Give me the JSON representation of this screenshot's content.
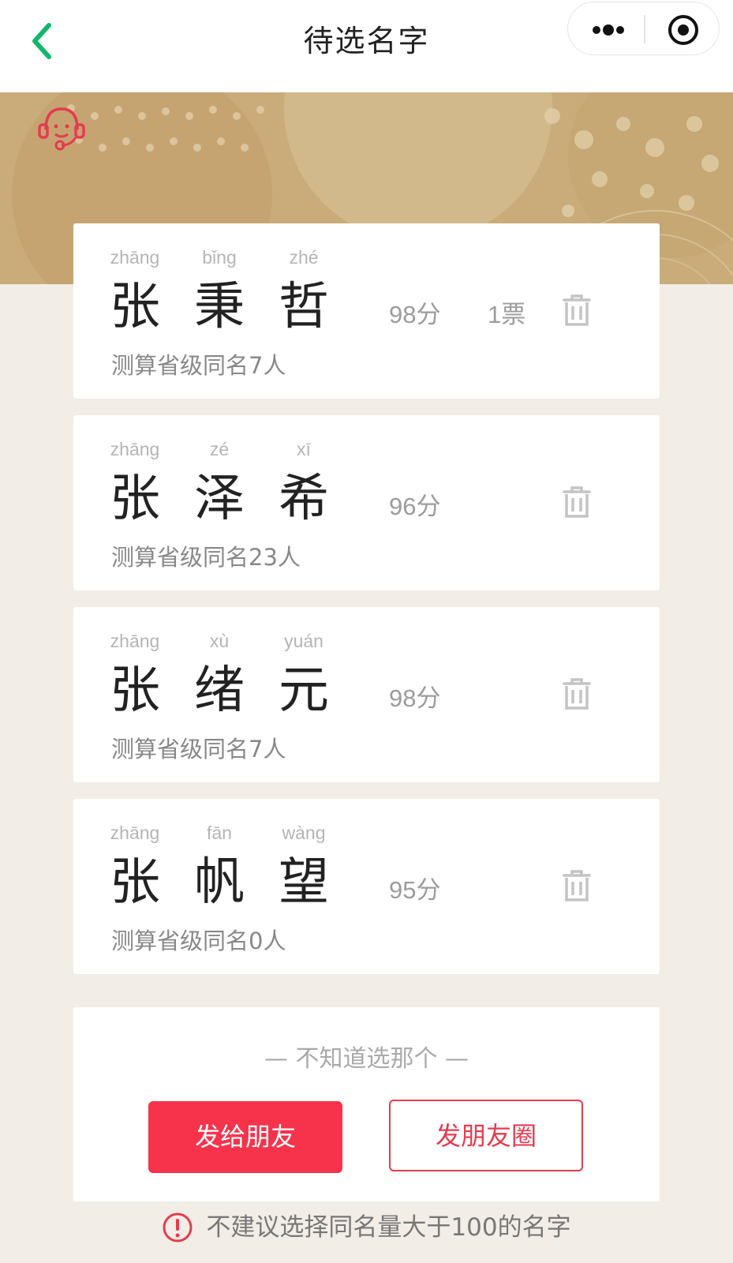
{
  "nav": {
    "title": "待选名字",
    "back_icon": "chevron-left-icon",
    "more_icon": "more-dots-icon",
    "close_icon": "target-circle-icon",
    "accent": "#12b76a"
  },
  "banner": {
    "service_icon": "customer-service-icon",
    "color": "#c9ac7a"
  },
  "names": [
    {
      "chars": [
        "张",
        "秉",
        "哲"
      ],
      "pinyin": [
        "zhāng",
        "bǐng",
        "zhé"
      ],
      "score": "98分",
      "votes": "1票",
      "same_name": "测算省级同名7人"
    },
    {
      "chars": [
        "张",
        "泽",
        "希"
      ],
      "pinyin": [
        "zhāng",
        "zé",
        "xī"
      ],
      "score": "96分",
      "votes": "",
      "same_name": "测算省级同名23人"
    },
    {
      "chars": [
        "张",
        "绪",
        "元"
      ],
      "pinyin": [
        "zhāng",
        "xù",
        "yuán"
      ],
      "score": "98分",
      "votes": "",
      "same_name": "测算省级同名7人"
    },
    {
      "chars": [
        "张",
        "帆",
        "望"
      ],
      "pinyin": [
        "zhāng",
        "fān",
        "wàng"
      ],
      "score": "95分",
      "votes": "",
      "same_name": "测算省级同名0人"
    }
  ],
  "share": {
    "hint": "— 不知道选那个 —",
    "friend_button": "发给朋友",
    "moments_button": "发朋友圈",
    "primary_color": "#f6334b"
  },
  "warning": {
    "icon": "exclamation-circle-icon",
    "text": "不建议选择同名量大于100的名字",
    "color": "#e53b4f"
  }
}
